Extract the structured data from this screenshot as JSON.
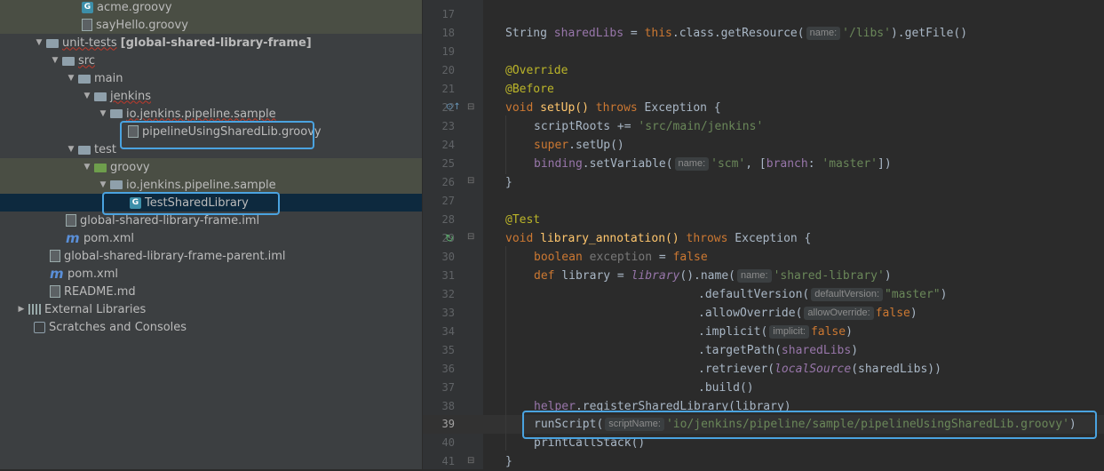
{
  "tree": {
    "items": [
      {
        "label": "acme.groovy"
      },
      {
        "label": "sayHello.groovy"
      },
      {
        "label": "unit-tests",
        "suffix": "[global-shared-library-frame]"
      },
      {
        "label": "src"
      },
      {
        "label": "main"
      },
      {
        "label": "jenkins"
      },
      {
        "label": "io.jenkins.pipeline.sample"
      },
      {
        "label": "pipelineUsingSharedLib.groovy"
      },
      {
        "label": "test"
      },
      {
        "label": "groovy"
      },
      {
        "label": "io.jenkins.pipeline.sample"
      },
      {
        "label": "TestSharedLibrary"
      },
      {
        "label": "global-shared-library-frame.iml"
      },
      {
        "label": "pom.xml"
      },
      {
        "label": "global-shared-library-frame-parent.iml"
      },
      {
        "label": "pom.xml"
      },
      {
        "label": "README.md"
      },
      {
        "label": "External Libraries"
      },
      {
        "label": "Scratches and Consoles"
      }
    ],
    "groovy_badge": "G",
    "module_badge": "m"
  },
  "editor": {
    "line_numbers": [
      "17",
      "18",
      "19",
      "20",
      "21",
      "22",
      "23",
      "24",
      "25",
      "26",
      "27",
      "28",
      "29",
      "30",
      "31",
      "32",
      "33",
      "34",
      "35",
      "36",
      "37",
      "38",
      "39",
      "40",
      "41"
    ],
    "tokens": {
      "string": "String",
      "sharedLibs": "sharedLibs",
      "eq": " = ",
      "this": "this",
      "class_call": ".class.getResource(",
      "hint_name": "name:",
      "libs_str": "'/libs'",
      "getfile": ").getFile()",
      "override": "@Override",
      "before": "@Before",
      "void": "void",
      "setup": " setUp() ",
      "throws": "throws",
      "exc_brace": " Exception {",
      "scriptRoots": "scriptRoots += ",
      "src_main": "'src/main/jenkins'",
      "super": "super",
      "super_setup": ".setUp()",
      "binding": "binding",
      "setVariable": ".setVariable(",
      "scm": "'scm'",
      "branch_open": ", [",
      "branch": "branch",
      "colon": ": ",
      "master": "'master'",
      "branch_close": "])",
      "close_brace": "}",
      "test_ann": "@Test",
      "lib_ann": " library_annotation() ",
      "boolean": "boolean",
      "exception_var": " exception",
      "false": "false",
      "def": "def",
      "library_var": " library = ",
      "library_fn": "library",
      "name_call": "().name(",
      "shared_library": "'shared-library'",
      "close_paren": ")",
      "defaultVersion": ".defaultVersion(",
      "hint_defaultVersion": "defaultVersion:",
      "master_dq": "\"master\"",
      "allowOverride": ".allowOverride(",
      "hint_allowOverride": "allowOverride:",
      "implicit": ".implicit(",
      "hint_implicit": "implicit:",
      "targetPath": ".targetPath(",
      "retriever": ".retriever(",
      "localSource": "localSource",
      "sharedLibs_close": "(sharedLibs))",
      "build": ".build()",
      "helper": "helper",
      "registerSharedLibrary": ".registerSharedLibrary(library)",
      "runScript": "runScript(",
      "hint_scriptName": "scriptName:",
      "script_path": "'io/jenkins/pipeline/sample/pipelineUsingSharedLib.groovy'",
      "printCallStack": "printCallStack()"
    }
  },
  "colors": {
    "highlight_box": "#4aa3e0",
    "selection": "#0d293e",
    "keyword": "#cc7832",
    "string": "#6a8759",
    "annotation": "#bbb529"
  }
}
